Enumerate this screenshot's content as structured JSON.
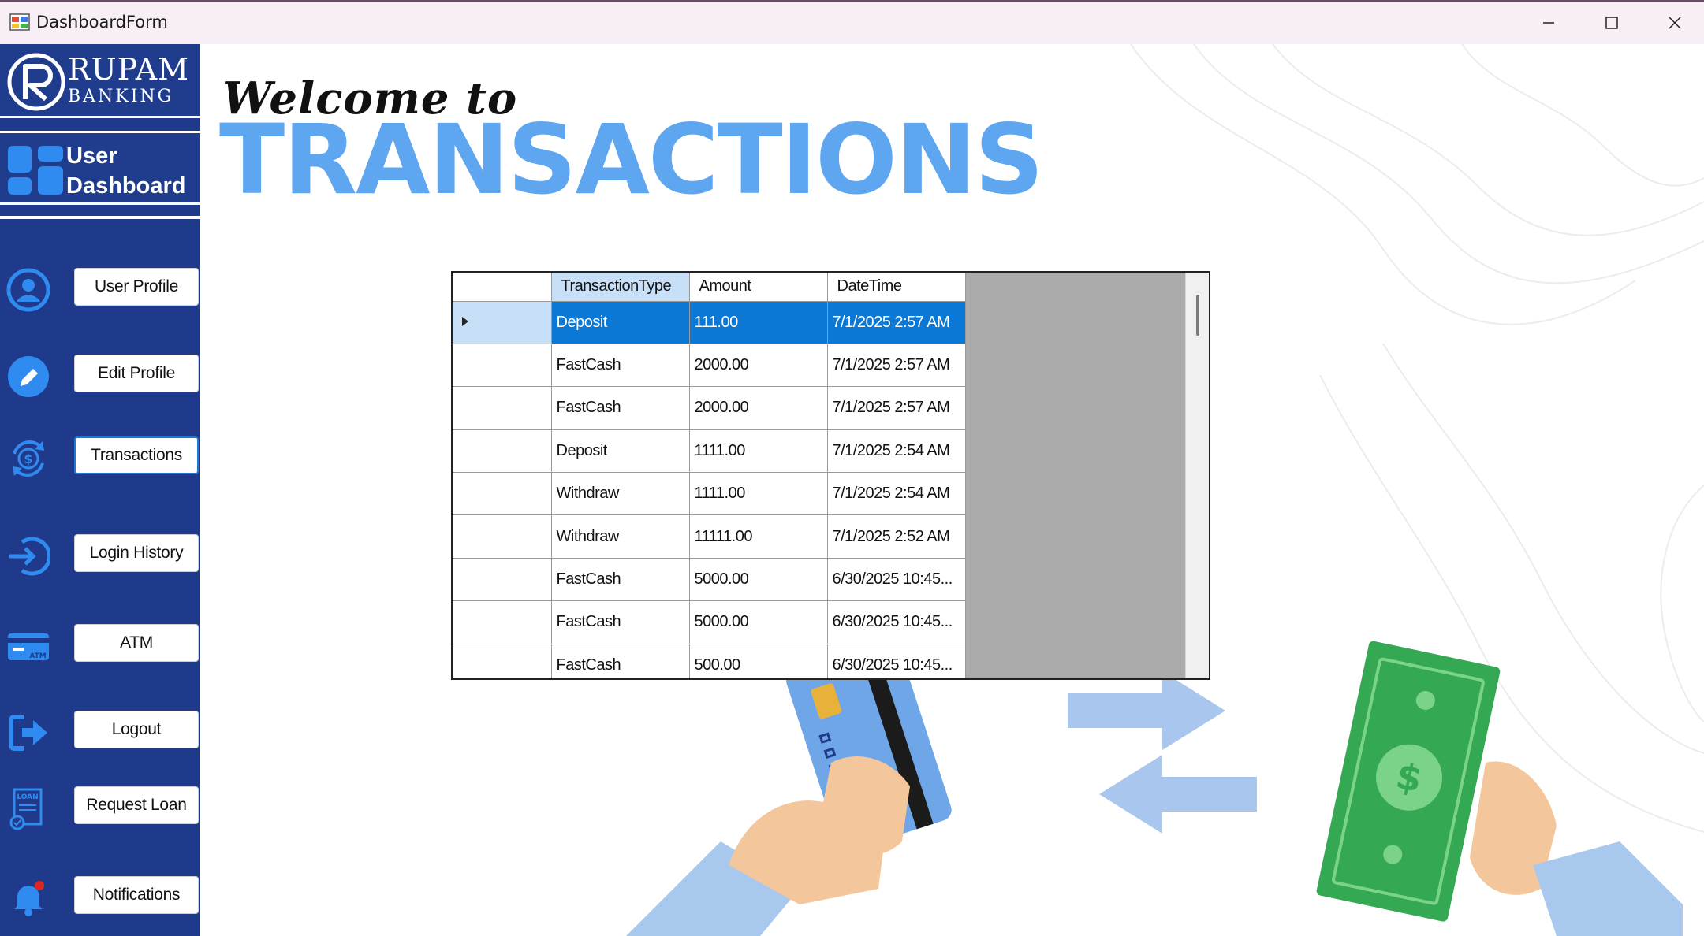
{
  "window": {
    "title": "DashboardForm",
    "minimize_icon": "minimize-icon",
    "maximize_icon": "maximize-icon",
    "close_icon": "close-icon"
  },
  "brand": {
    "name": "RUPAM",
    "sub": "BANKING"
  },
  "dashboard": {
    "line1": "User",
    "line2": "Dashboard"
  },
  "nav": [
    {
      "label": "User Profile",
      "icon": "user-circle-icon"
    },
    {
      "label": "Edit Profile",
      "icon": "pencil-icon"
    },
    {
      "label": "Transactions",
      "icon": "dollar-cycle-icon",
      "active": true
    },
    {
      "label": "Login History",
      "icon": "login-arrow-icon"
    },
    {
      "label": "ATM",
      "icon": "atm-card-icon"
    },
    {
      "label": "Logout",
      "icon": "logout-icon"
    },
    {
      "label": "Request Loan",
      "icon": "loan-document-icon"
    },
    {
      "label": "Notifications",
      "icon": "bell-icon"
    }
  ],
  "heading": {
    "welcome": "Welcome to",
    "title": "TRANSACTIONS"
  },
  "grid": {
    "columns": [
      "TransactionType",
      "Amount",
      "DateTime"
    ],
    "rows": [
      [
        "Deposit",
        "111.00",
        "7/1/2025 2:57 AM"
      ],
      [
        "FastCash",
        "2000.00",
        "7/1/2025 2:57 AM"
      ],
      [
        "FastCash",
        "2000.00",
        "7/1/2025 2:57 AM"
      ],
      [
        "Deposit",
        "1111.00",
        "7/1/2025 2:54 AM"
      ],
      [
        "Withdraw",
        "1111.00",
        "7/1/2025 2:54 AM"
      ],
      [
        "Withdraw",
        "11111.00",
        "7/1/2025 2:52 AM"
      ],
      [
        "FastCash",
        "5000.00",
        "6/30/2025 10:45..."
      ],
      [
        "FastCash",
        "5000.00",
        "6/30/2025 10:45..."
      ],
      [
        "FastCash",
        "500.00",
        "6/30/2025 10:45..."
      ]
    ],
    "selected_row": 0
  },
  "colors": {
    "sidebar": "#1f3a8a",
    "accent": "#5fa6f0",
    "selection": "#0a78d4"
  }
}
